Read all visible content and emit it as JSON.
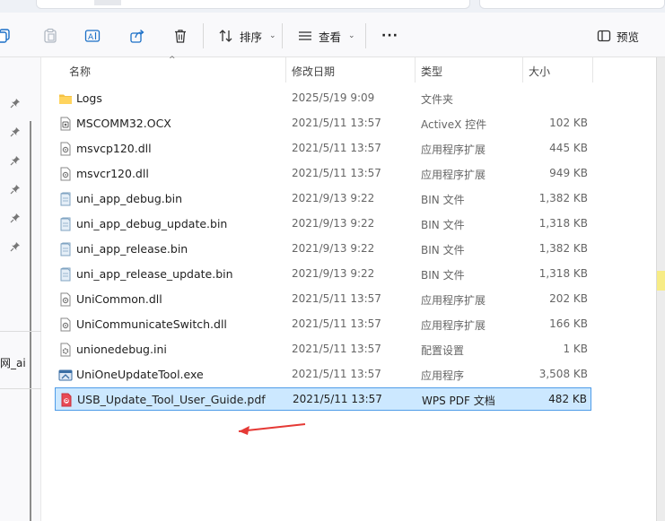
{
  "toolbar": {
    "sort_label": "排序",
    "view_label": "查看",
    "more_label": "···",
    "preview_label": "预览"
  },
  "nav": {
    "clipped_item": "网_ai"
  },
  "columns": {
    "name": "名称",
    "modified": "修改日期",
    "type": "类型",
    "size": "大小"
  },
  "files": [
    {
      "name": "Logs",
      "modified": "2025/5/19 9:09",
      "type": "文件夹",
      "size": "",
      "icon": "folder-icon"
    },
    {
      "name": "MSCOMM32.OCX",
      "modified": "2021/5/11 13:57",
      "type": "ActiveX 控件",
      "size": "102 KB",
      "icon": "ocx-file-icon"
    },
    {
      "name": "msvcp120.dll",
      "modified": "2021/5/11 13:57",
      "type": "应用程序扩展",
      "size": "445 KB",
      "icon": "dll-file-icon"
    },
    {
      "name": "msvcr120.dll",
      "modified": "2021/5/11 13:57",
      "type": "应用程序扩展",
      "size": "949 KB",
      "icon": "dll-file-icon"
    },
    {
      "name": "uni_app_debug.bin",
      "modified": "2021/9/13 9:22",
      "type": "BIN 文件",
      "size": "1,382 KB",
      "icon": "bin-file-icon"
    },
    {
      "name": "uni_app_debug_update.bin",
      "modified": "2021/9/13 9:22",
      "type": "BIN 文件",
      "size": "1,318 KB",
      "icon": "bin-file-icon"
    },
    {
      "name": "uni_app_release.bin",
      "modified": "2021/9/13 9:22",
      "type": "BIN 文件",
      "size": "1,382 KB",
      "icon": "bin-file-icon"
    },
    {
      "name": "uni_app_release_update.bin",
      "modified": "2021/9/13 9:22",
      "type": "BIN 文件",
      "size": "1,318 KB",
      "icon": "bin-file-icon"
    },
    {
      "name": "UniCommon.dll",
      "modified": "2021/5/11 13:57",
      "type": "应用程序扩展",
      "size": "202 KB",
      "icon": "dll-file-icon"
    },
    {
      "name": "UniCommunicateSwitch.dll",
      "modified": "2021/5/11 13:57",
      "type": "应用程序扩展",
      "size": "166 KB",
      "icon": "dll-file-icon"
    },
    {
      "name": "unionedebug.ini",
      "modified": "2021/5/11 13:57",
      "type": "配置设置",
      "size": "1 KB",
      "icon": "ini-file-icon"
    },
    {
      "name": "UniOneUpdateTool.exe",
      "modified": "2021/5/11 13:57",
      "type": "应用程序",
      "size": "3,508 KB",
      "icon": "exe-file-icon"
    },
    {
      "name": "USB_Update_Tool_User_Guide.pdf",
      "modified": "2021/5/11 13:57",
      "type": "WPS PDF 文档",
      "size": "482 KB",
      "icon": "pdf-file-icon",
      "selected": true
    }
  ],
  "colors": {
    "selection_bg": "#cce8ff",
    "selection_border": "#4f9ce8",
    "annotation_arrow": "#e53935",
    "folder": "#f5c244"
  }
}
